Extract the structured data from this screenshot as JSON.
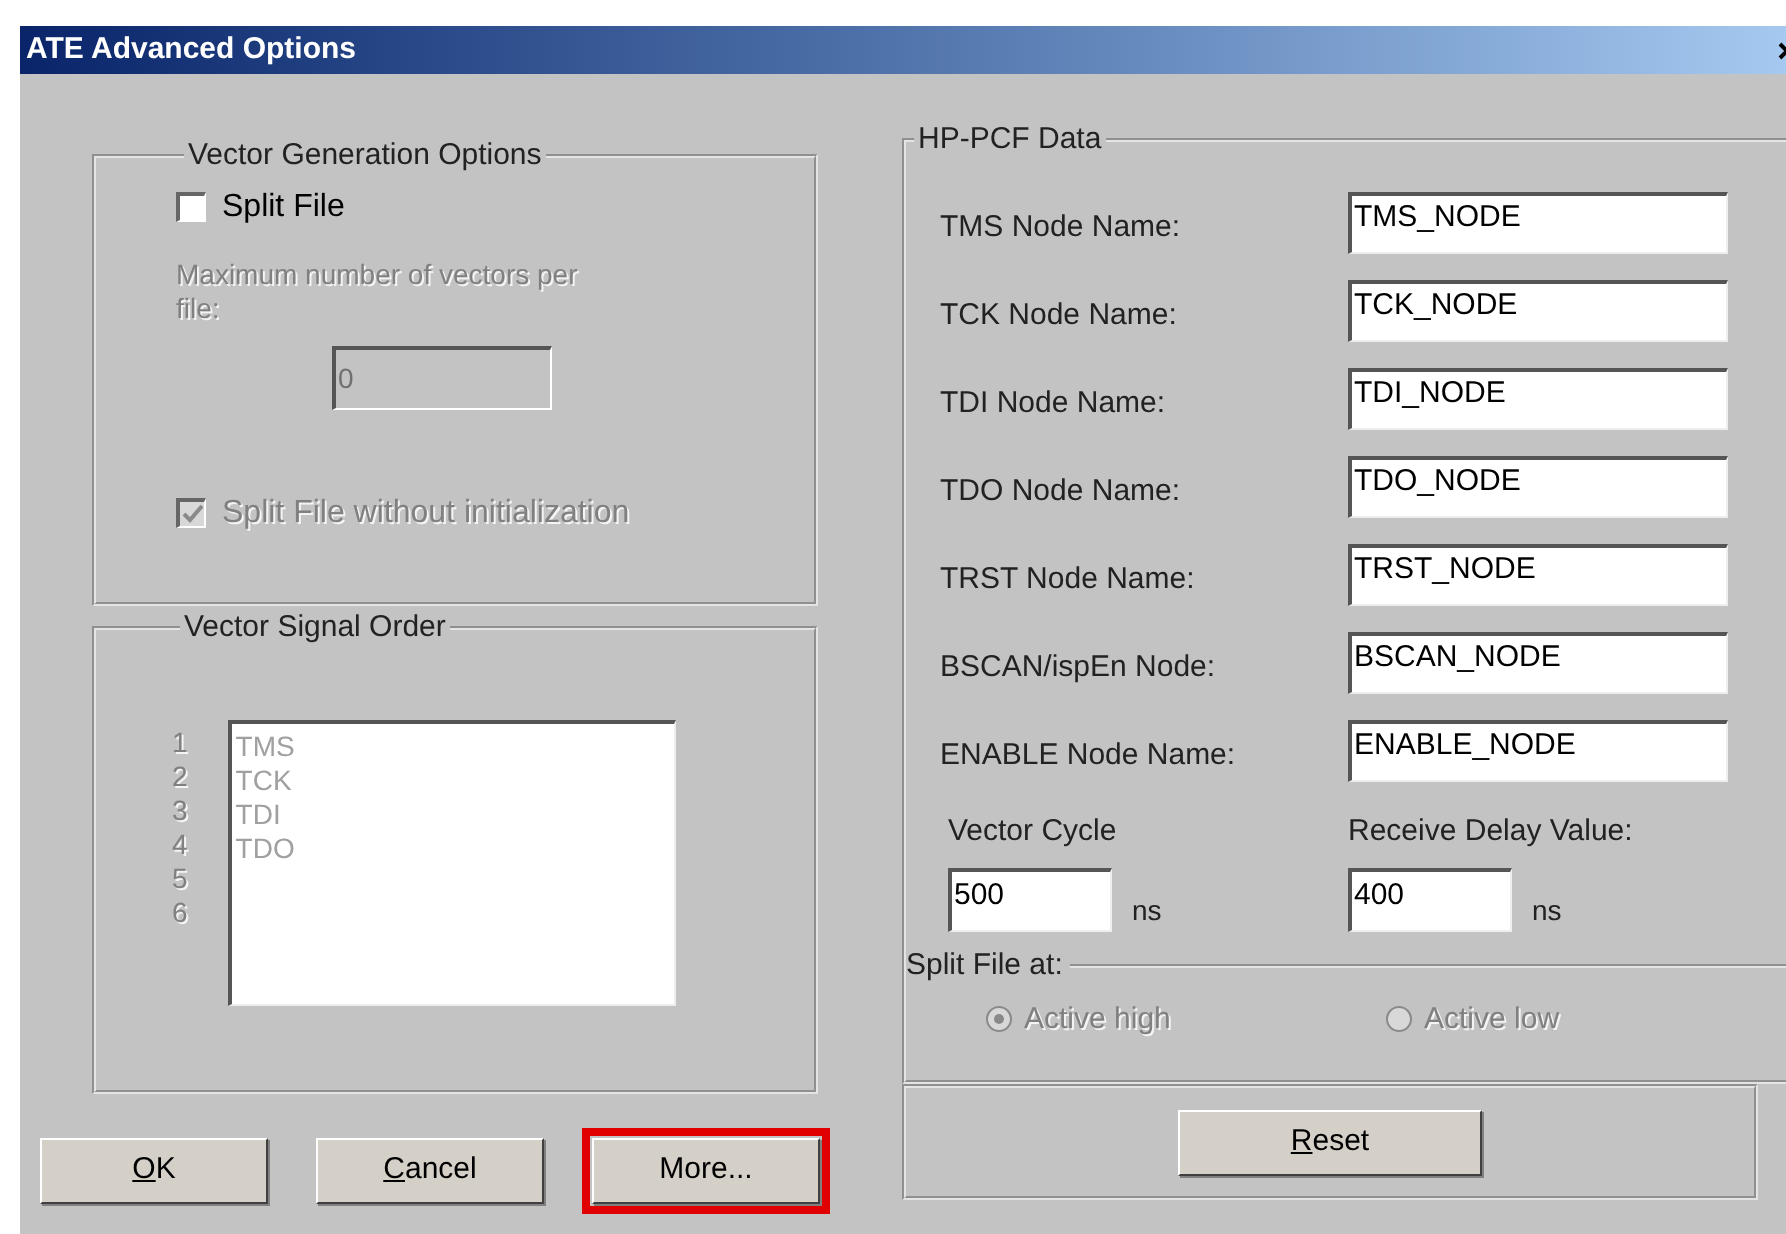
{
  "window": {
    "title": "ATE Advanced Options"
  },
  "vector_generation": {
    "title": "Vector Generation Options",
    "split_file": {
      "label": "Split File",
      "checked": false,
      "disabled": false
    },
    "max_vectors": {
      "label": "Maximum number of vectors per file:",
      "value": "0",
      "disabled": true
    },
    "split_without_init": {
      "label": "Split File without initialization",
      "checked": true,
      "disabled": true
    }
  },
  "signal_order": {
    "title": "Vector Signal Order",
    "numbers": [
      "1",
      "2",
      "3",
      "4",
      "5",
      "6"
    ],
    "items": [
      "TMS",
      "TCK",
      "TDI",
      "TDO"
    ],
    "disabled": true
  },
  "buttons": [
    {
      "label": "OK",
      "mnemonic": true,
      "highlighted": false
    },
    {
      "label": "Cancel",
      "mnemonic": true,
      "highlighted": false
    },
    {
      "label": "More...",
      "mnemonic": false,
      "highlighted": true
    }
  ],
  "hp_pcf": {
    "title": "HP-PCF Data",
    "fields": [
      {
        "label": "TMS Node Name:",
        "value": "TMS_NODE"
      },
      {
        "label": "TCK Node Name:",
        "value": "TCK_NODE"
      },
      {
        "label": "TDI Node Name:",
        "value": "TDI_NODE"
      },
      {
        "label": "TDO Node Name:",
        "value": "TDO_NODE"
      },
      {
        "label": "TRST Node Name:",
        "value": "TRST_NODE"
      },
      {
        "label": "BSCAN/ispEn Node:",
        "value": "BSCAN_NODE"
      },
      {
        "label": "ENABLE Node Name:",
        "value": "ENABLE_NODE"
      }
    ],
    "timings": [
      {
        "label": "Vector Cycle",
        "value": "500",
        "unit": "ns"
      },
      {
        "label": "Receive Delay Value:",
        "value": "400",
        "unit": "ns"
      }
    ],
    "split_at": {
      "title": "Split File at:",
      "options": [
        {
          "label": "Active high",
          "selected": true,
          "disabled": true
        },
        {
          "label": "Active low",
          "selected": false,
          "disabled": true
        }
      ]
    }
  },
  "reset_button": {
    "label": "Reset",
    "mnemonic": true
  }
}
